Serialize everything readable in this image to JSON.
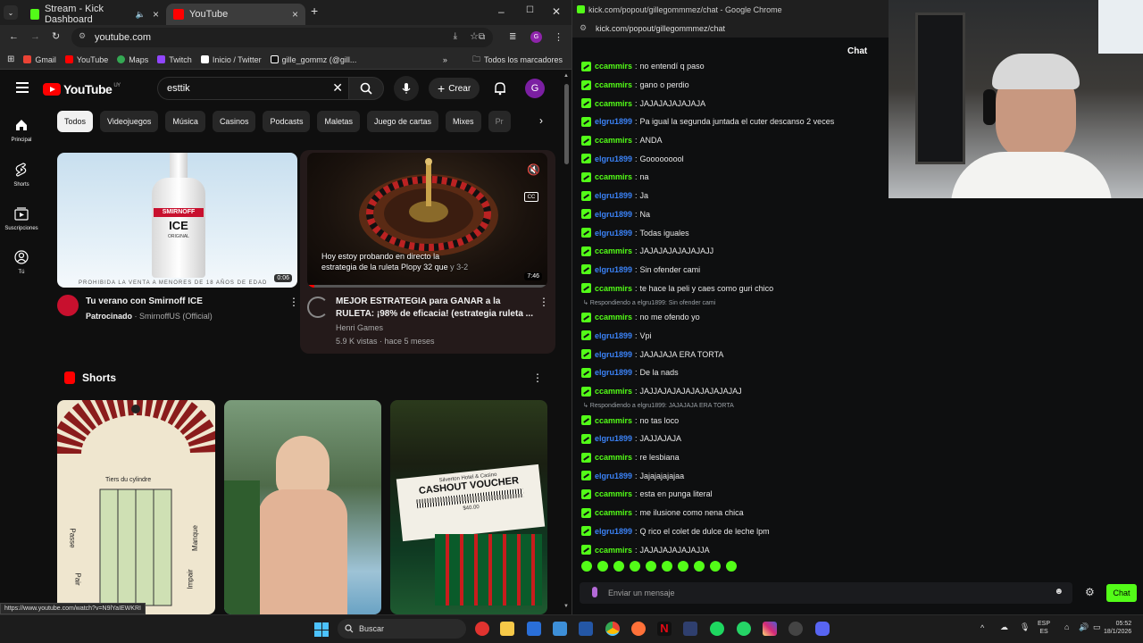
{
  "left_browser": {
    "tabs": [
      {
        "label": "Stream - Kick Dashboard",
        "active": false
      },
      {
        "label": "YouTube",
        "active": true
      }
    ],
    "url": "youtube.com",
    "bookmarks": [
      "Gmail",
      "YouTube",
      "Maps",
      "Twitch",
      "Inicio / Twitter",
      "gille_gommz (@gill..."
    ],
    "bookmarks_all": "Todos los marcadores",
    "status_url": "https://www.youtube.com/watch?v=N9lYaIEWKRI"
  },
  "youtube": {
    "logo": "YouTube",
    "logo_region": "UY",
    "search_value": "esttik",
    "create_label": "Crear",
    "avatar_letter": "G",
    "chips": [
      "Todos",
      "Videojuegos",
      "Música",
      "Casinos",
      "Podcasts",
      "Maletas",
      "Juego de cartas",
      "Mixes",
      "Pr"
    ],
    "guide": [
      {
        "label": "Principal",
        "icon": "home-icon"
      },
      {
        "label": "Shorts",
        "icon": "shorts-icon"
      },
      {
        "label": "Suscripciones",
        "icon": "subscriptions-icon"
      },
      {
        "label": "Tú",
        "icon": "you-icon"
      }
    ],
    "videos": [
      {
        "title": "Tu verano con Smirnoff ICE",
        "channel_prefix": "Patrocinado",
        "channel": "SmirnoffUS (Official)",
        "duration": "0:06",
        "thumb_caption": "PROHIBIDA LA VENTA A MENORES DE 18 AÑOS DE EDAD",
        "bottle_brand": "SMIRNOFF",
        "bottle_ice": "ICE",
        "bottle_original": "ORIGINAL"
      },
      {
        "title_line1": "MEJOR ESTRATEGIA para GANAR a la",
        "title_line2": "RULETA: ¡98% de eficacia! (estrategia ruleta ...",
        "channel": "Henri Games",
        "meta": "5.9 K vistas · hace 5 meses",
        "duration": "7:46",
        "caption_line1": "Hoy estoy probando en directo la",
        "caption_line2": "estrategia de la ruleta Plopy 32 que",
        "caption_extra": "y 3-2"
      }
    ],
    "shorts_title": "Shorts",
    "shorts": [
      {
        "thumb_texts": [
          "Tiers du cylindre",
          "Passe",
          "Manque",
          "Pair",
          "Impair"
        ]
      },
      {
        "thumb_texts": []
      },
      {
        "thumb_texts": [
          "Silverton Hotel & Casino",
          "CASHOUT VOUCHER",
          "$40.00"
        ]
      }
    ]
  },
  "right_browser": {
    "title": "kick.com/popout/gillegommmez/chat - Google Chrome",
    "url": "kick.com/popout/gillegommmez/chat",
    "chat_header": "Chat",
    "messages": [
      {
        "user": "ccammirs",
        "color": "#53fc18",
        "text": "no entendí q paso"
      },
      {
        "user": "ccammirs",
        "color": "#53fc18",
        "text": "gano o perdio"
      },
      {
        "user": "ccammirs",
        "color": "#53fc18",
        "text": "JAJAJAJAJAJAJA"
      },
      {
        "user": "elgru1899",
        "color": "#3b82f6",
        "text": "Pa igual la segunda juntada el cuter descanso 2 veces"
      },
      {
        "user": "ccammirs",
        "color": "#53fc18",
        "text": "ANDA"
      },
      {
        "user": "elgru1899",
        "color": "#3b82f6",
        "text": "Gooooooool"
      },
      {
        "user": "ccammirs",
        "color": "#53fc18",
        "text": "na"
      },
      {
        "user": "elgru1899",
        "color": "#3b82f6",
        "text": "Ja"
      },
      {
        "user": "elgru1899",
        "color": "#3b82f6",
        "text": "Na"
      },
      {
        "user": "elgru1899",
        "color": "#3b82f6",
        "text": "Todas iguales"
      },
      {
        "user": "ccammirs",
        "color": "#53fc18",
        "text": "JAJAJAJAJAJAJAJJ"
      },
      {
        "user": "elgru1899",
        "color": "#3b82f6",
        "text": "Sin ofender cami"
      },
      {
        "user": "ccammirs",
        "color": "#53fc18",
        "text": "te hace la peli y caes como guri chico"
      },
      {
        "reply": "Respondiendo a elgru1899: Sin ofender cami",
        "user": "ccammirs",
        "color": "#53fc18",
        "text": "no me ofendo yo"
      },
      {
        "user": "elgru1899",
        "color": "#3b82f6",
        "text": "Vpi"
      },
      {
        "user": "elgru1899",
        "color": "#3b82f6",
        "text": "JAJAJAJA ERA TORTA"
      },
      {
        "user": "elgru1899",
        "color": "#3b82f6",
        "text": "De la nads"
      },
      {
        "user": "ccammirs",
        "color": "#53fc18",
        "text": "JAJJAJAJAJAJAJAJAJAJAJ"
      },
      {
        "reply": "Respondiendo a elgru1899: JAJAJAJA ERA TORTA",
        "user": "ccammirs",
        "color": "#53fc18",
        "text": "no tas loco"
      },
      {
        "user": "elgru1899",
        "color": "#3b82f6",
        "text": "JAJJAJAJA"
      },
      {
        "user": "ccammirs",
        "color": "#53fc18",
        "text": "re lesbiana"
      },
      {
        "user": "elgru1899",
        "color": "#3b82f6",
        "text": "Jajajajajajaa"
      },
      {
        "user": "ccammirs",
        "color": "#53fc18",
        "text": "esta en punga literal"
      },
      {
        "user": "ccammirs",
        "color": "#53fc18",
        "text": "me ilusione como nena chica"
      },
      {
        "user": "elgru1899",
        "color": "#3b82f6",
        "text": "Q rico el colet de dulce de leche lpm"
      },
      {
        "user": "ccammirs",
        "color": "#53fc18",
        "text": "JAJAJAJAJAJAJJA"
      }
    ],
    "input_placeholder": "Enviar un mensaje",
    "send_label": "Chat",
    "accent_color": "#53fc18"
  },
  "taskbar": {
    "search_label": "Buscar",
    "lang_line1": "ESP",
    "lang_line2": "ES",
    "time": "05:52",
    "date": "18/1/2026"
  }
}
